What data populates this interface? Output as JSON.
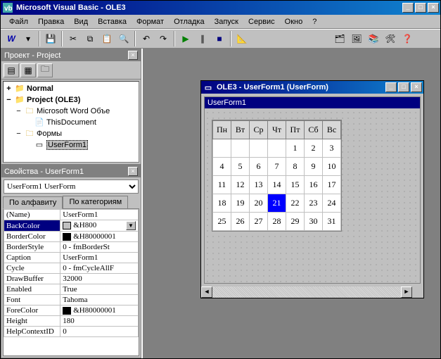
{
  "window": {
    "title": "Microsoft Visual Basic - OLE3"
  },
  "menu": [
    "Файл",
    "Правка",
    "Вид",
    "Вставка",
    "Формат",
    "Отладка",
    "Запуск",
    "Сервис",
    "Окно",
    "?"
  ],
  "project_panel": {
    "title": "Проект - Project",
    "tree": {
      "normal": "Normal",
      "project": "Project (OLE3)",
      "word_objs": "Microsoft Word Объе",
      "this_document": "ThisDocument",
      "forms": "Формы",
      "userform": "UserForm1"
    }
  },
  "props_panel": {
    "title": "Свойства - UserForm1",
    "combo_label": "UserForm1 UserForm",
    "tab_alpha": "По алфавиту",
    "tab_cat": "По категориям",
    "rows": [
      {
        "name": "(Name)",
        "value": "UserForm1"
      },
      {
        "name": "BackColor",
        "value": "&H800",
        "swatch": "#c0c0c0",
        "sel": true,
        "dd": true
      },
      {
        "name": "BorderColor",
        "value": "&H80000001",
        "swatch": "#000000"
      },
      {
        "name": "BorderStyle",
        "value": "0 - fmBorderSt"
      },
      {
        "name": "Caption",
        "value": "UserForm1"
      },
      {
        "name": "Cycle",
        "value": "0 - fmCycleAllF"
      },
      {
        "name": "DrawBuffer",
        "value": "32000"
      },
      {
        "name": "Enabled",
        "value": "True"
      },
      {
        "name": "Font",
        "value": "Tahoma"
      },
      {
        "name": "ForeColor",
        "value": "&H80000001",
        "swatch": "#000000"
      },
      {
        "name": "Height",
        "value": "180"
      },
      {
        "name": "HelpContextID",
        "value": "0"
      }
    ]
  },
  "mdi": {
    "title": "OLE3 - UserForm1 (UserForm)",
    "form_caption": "UserForm1",
    "calendar": {
      "days": [
        "Пн",
        "Вт",
        "Ср",
        "Чт",
        "Пт",
        "Сб",
        "Вс"
      ],
      "rows": [
        [
          "",
          "",
          "",
          "",
          "1",
          "2",
          "3"
        ],
        [
          "4",
          "5",
          "6",
          "7",
          "8",
          "9",
          "10"
        ],
        [
          "11",
          "12",
          "13",
          "14",
          "15",
          "16",
          "17"
        ],
        [
          "18",
          "19",
          "20",
          "21",
          "22",
          "23",
          "24"
        ],
        [
          "25",
          "26",
          "27",
          "28",
          "29",
          "30",
          "31"
        ]
      ],
      "selected": "21"
    }
  }
}
